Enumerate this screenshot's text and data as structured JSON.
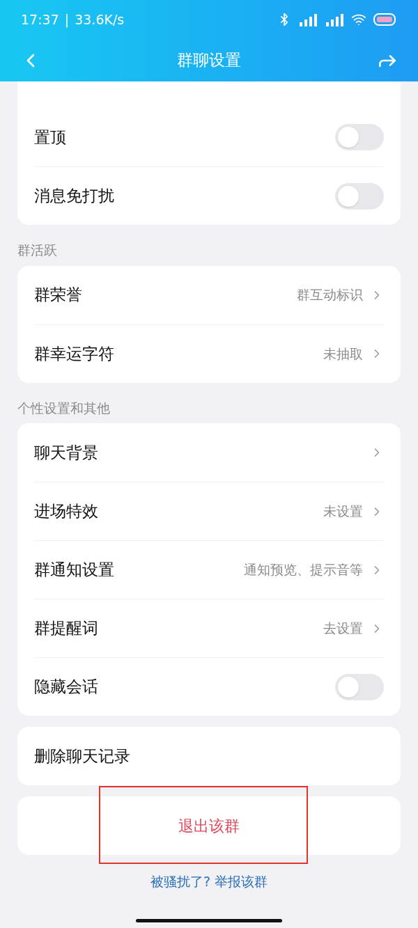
{
  "status_bar": {
    "time": "17:37",
    "separator": "|",
    "speed": "33.6K/s"
  },
  "header": {
    "title": "群聊设置"
  },
  "sections": [
    {
      "rows": [
        {
          "kind": "toggle",
          "label": "置顶",
          "on": false
        },
        {
          "kind": "toggle",
          "label": "消息免打扰",
          "on": false
        }
      ]
    },
    {
      "header": "群活跃",
      "rows": [
        {
          "kind": "link",
          "label": "群荣誉",
          "value": "群互动标识"
        },
        {
          "kind": "link",
          "label": "群幸运字符",
          "value": "未抽取"
        }
      ]
    },
    {
      "header": "个性设置和其他",
      "rows": [
        {
          "kind": "link",
          "label": "聊天背景"
        },
        {
          "kind": "link",
          "label": "进场特效",
          "value": "未设置"
        },
        {
          "kind": "link",
          "label": "群通知设置",
          "value": "通知预览、提示音等"
        },
        {
          "kind": "link",
          "label": "群提醒词",
          "value": "去设置"
        },
        {
          "kind": "toggle",
          "label": "隐藏会话",
          "on": false
        }
      ]
    },
    {
      "rows": [
        {
          "kind": "plain",
          "label": "删除聊天记录"
        }
      ]
    },
    {
      "rows": [
        {
          "kind": "danger",
          "label": "退出该群",
          "highlighted": true
        }
      ]
    }
  ],
  "report_link": "被骚扰了? 举报该群"
}
